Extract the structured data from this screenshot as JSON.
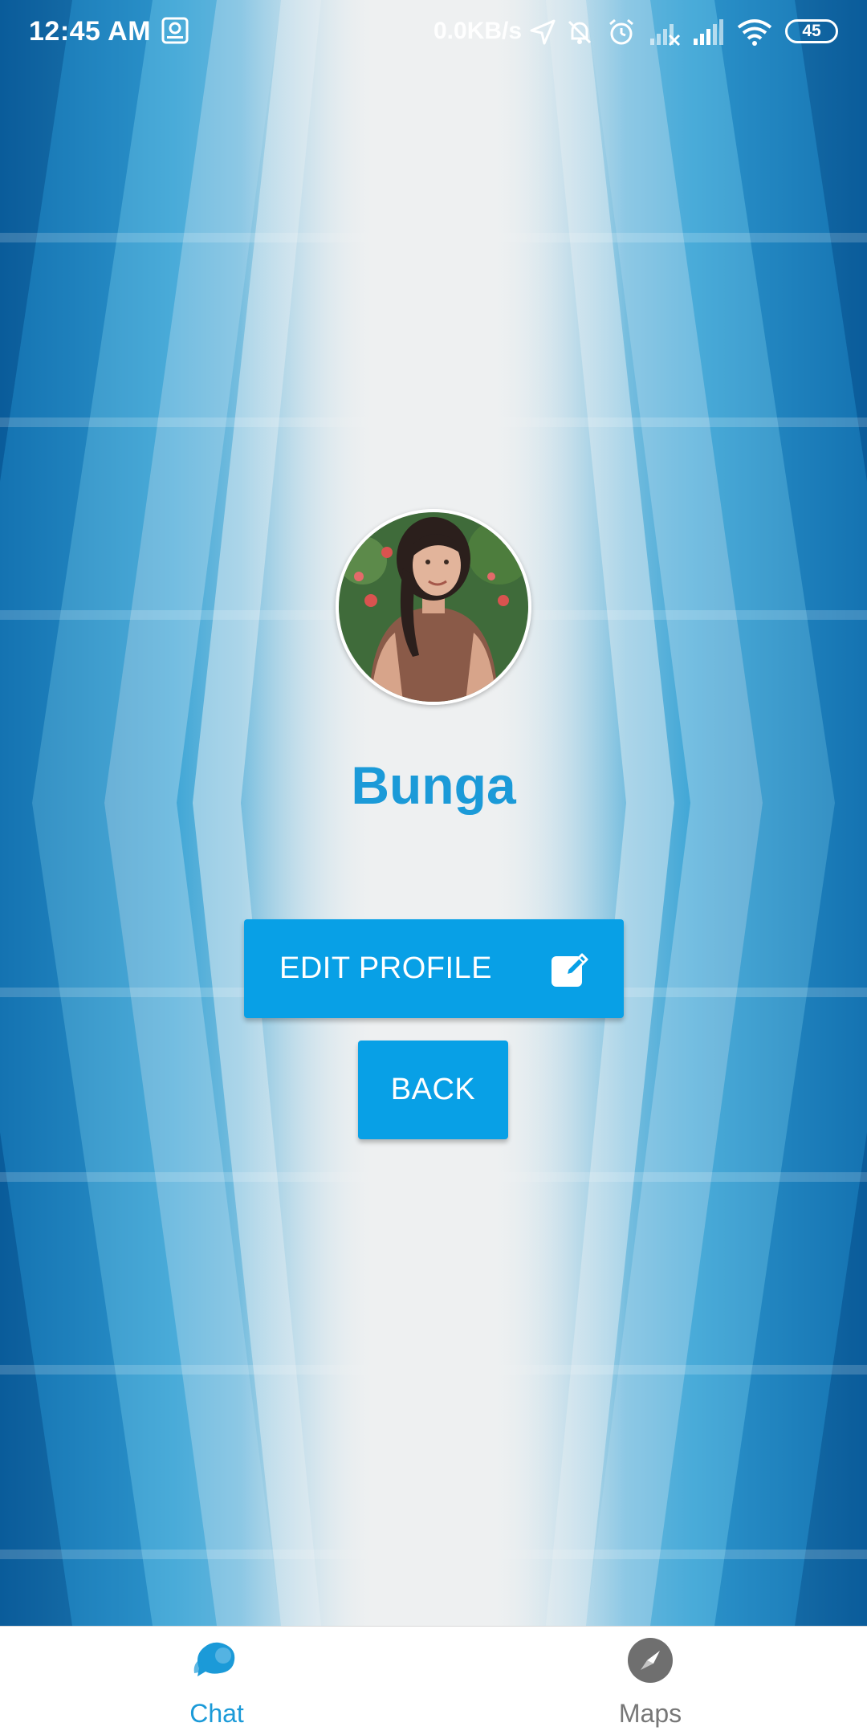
{
  "status_bar": {
    "time": "12:45 AM",
    "network_speed": "0.0KB/s",
    "battery": "45",
    "icons": [
      "app-notification-icon",
      "location-arrow-icon",
      "bell-off-icon",
      "alarm-icon",
      "signal-sim1-icon",
      "signal-sim2-icon",
      "wifi-icon",
      "battery-icon"
    ]
  },
  "profile": {
    "name": "Bunga",
    "avatar": "profile-photo"
  },
  "actions": {
    "edit_label": "EDIT PROFILE",
    "edit_icon": "edit-icon",
    "back_label": "BACK"
  },
  "bottom_nav": {
    "items": [
      {
        "label": "Chat",
        "icon": "chat-bubbles-icon",
        "active": true
      },
      {
        "label": "Maps",
        "icon": "compass-icon",
        "active": false
      }
    ]
  },
  "colors": {
    "accent": "#08a0e6",
    "name_text": "#1b9ad8",
    "background_blue": "#0a6fb0",
    "nav_active": "#1b9ad8",
    "nav_inactive": "#777777"
  }
}
